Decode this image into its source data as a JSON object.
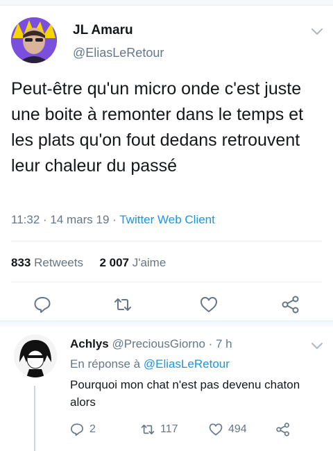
{
  "tweet": {
    "author_name": "JL Amaru",
    "author_handle": "@EliasLeRetour",
    "text": "Peut-être qu'un micro onde c'est juste une boite à remonter dans le temps et les plats qu'on fout dedans retrouvent leur chaleur du passé",
    "time": "11:32 · 14 mars 19 · ",
    "client": "Twitter Web Client",
    "retweets_count": "833",
    "retweets_label": " Retweets",
    "likes_count": "2 007",
    "likes_label": " J'aime"
  },
  "reply": {
    "author_name": "Achlys",
    "author_meta": " @PreciousGiorno · 7 h",
    "in_reply_prefix": "En réponse à ",
    "in_reply_handle": "@EliasLeRetour",
    "text": "Pourquoi mon chat n'est pas devenu chaton alors",
    "reply_count": "2",
    "retweet_count": "117",
    "like_count": "494"
  },
  "colors": {
    "link": "#1b95e0",
    "secondary_text": "#657786",
    "icon": "#657786",
    "divider": "#e6ecf0"
  },
  "icons": [
    "chevron-down-icon",
    "reply-icon",
    "retweet-icon",
    "like-icon",
    "share-icon"
  ]
}
